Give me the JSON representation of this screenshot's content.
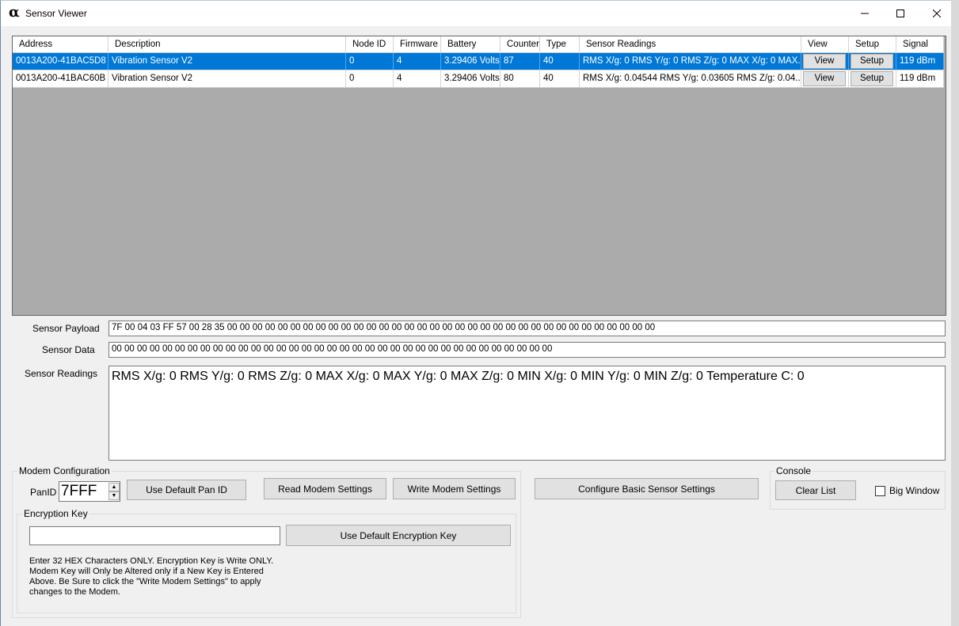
{
  "window": {
    "title": "Sensor Viewer",
    "icon": "alpha-app-icon"
  },
  "grid": {
    "columns": [
      "Address",
      "Description",
      "Node ID",
      "Firmware",
      "Battery",
      "Counter",
      "Type",
      "Sensor Readings",
      "View",
      "Setup",
      "Signal"
    ],
    "rows": [
      {
        "address": "0013A200-41BAC5D8",
        "description": "Vibration Sensor V2",
        "node_id": "0",
        "firmware": "4",
        "battery": "3.29406 Volts",
        "counter": "87",
        "type": "40",
        "readings": "RMS X/g: 0 RMS Y/g: 0 RMS Z/g: 0 MAX X/g: 0 MAX...",
        "view": "View",
        "setup": "Setup",
        "signal": "119 dBm",
        "selected": true
      },
      {
        "address": "0013A200-41BAC60B",
        "description": "Vibration Sensor V2",
        "node_id": "0",
        "firmware": "4",
        "battery": "3.29406 Volts",
        "counter": "80",
        "type": "40",
        "readings": "RMS X/g: 0.04544 RMS Y/g: 0.03605 RMS Z/g: 0.04...",
        "view": "View",
        "setup": "Setup",
        "signal": "119 dBm",
        "selected": false
      }
    ]
  },
  "fields": {
    "payload_label": "Sensor Payload",
    "payload_value": "7F 00 04 03 FF 57 00 28 35 00 00 00 00 00 00 00 00 00 00 00 00 00 00 00 00 00 00 00 00 00 00 00 00 00 00 00 00 00 00 00 00 00 00",
    "data_label": "Sensor Data",
    "data_value": "00 00 00 00 00 00 00 00 00 00 00 00 00 00 00 00 00 00 00 00 00 00 00 00 00 00 00 00 00 00 00 00 00 00 00",
    "readings_label": "Sensor Readings",
    "readings_value": "RMS X/g: 0 RMS Y/g: 0 RMS Z/g: 0 MAX X/g: 0 MAX Y/g: 0 MAX Z/g: 0 MIN X/g: 0 MIN Y/g: 0 MIN Z/g: 0 Temperature C: 0"
  },
  "modem": {
    "group_title": "Modem Configuration",
    "panid_label": "PanID",
    "panid_value": "7FFF",
    "default_pan_button": "Use Default Pan ID",
    "read_button": "Read Modem Settings",
    "write_button": "Write Modem Settings",
    "configure_button": "Configure Basic Sensor Settings"
  },
  "encryption": {
    "group_title": "Encryption Key",
    "key_value": "",
    "default_key_button": "Use Default Encryption Key",
    "note": "Enter 32 HEX Characters ONLY.  Encryption Key is Write ONLY.  Modem Key will Only be Altered only if a New Key is Entered Above.  Be Sure to click the \"Write Modem Settings\" to apply changes to the Modem."
  },
  "console": {
    "group_title": "Console",
    "clear_button": "Clear List",
    "big_window_label": "Big Window",
    "big_window_checked": false
  }
}
